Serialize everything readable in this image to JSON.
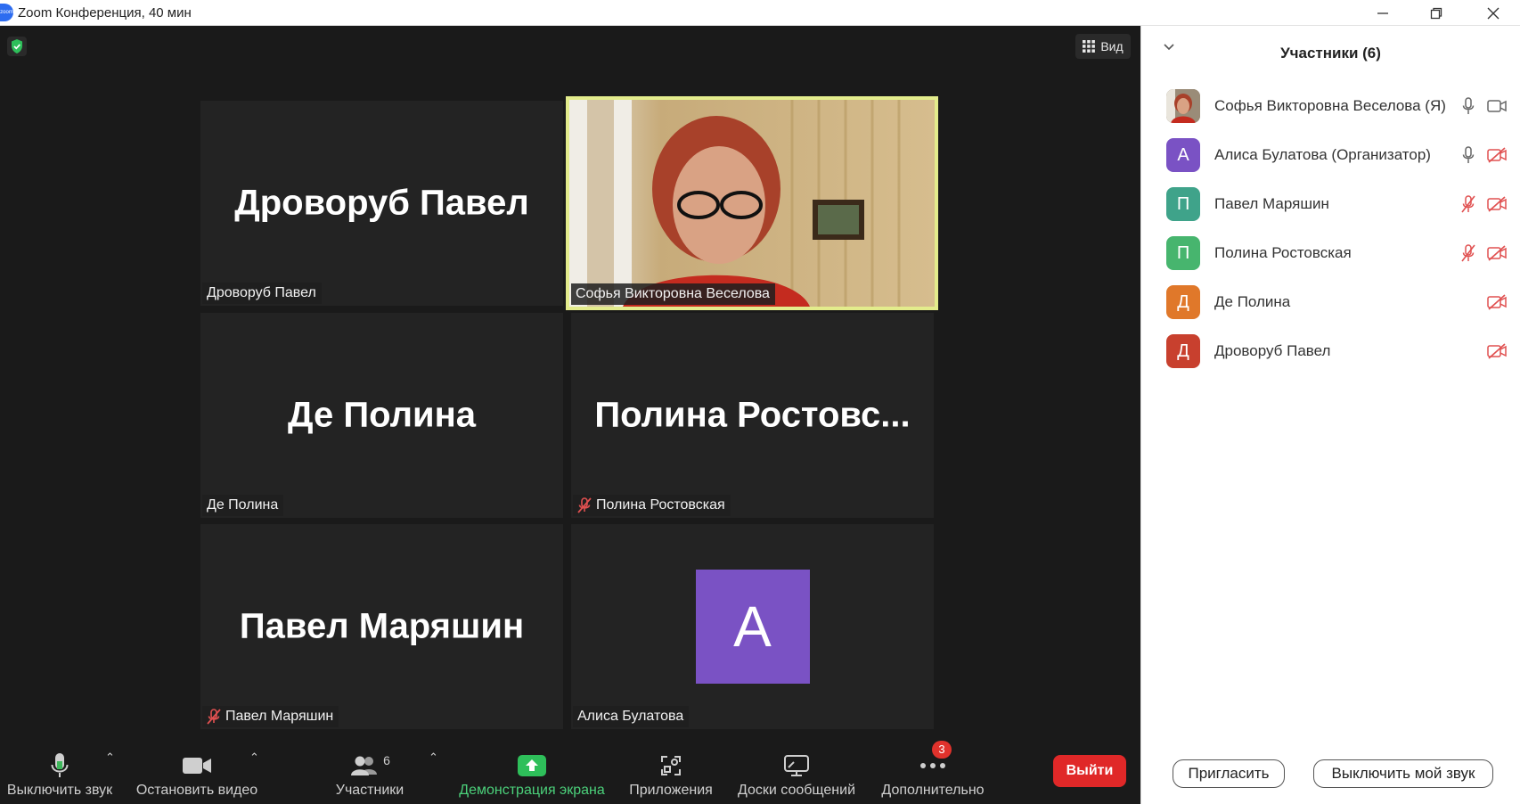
{
  "window": {
    "app_icon_text": "zoom",
    "title": "Zoom Конференция, 40 мин"
  },
  "meeting": {
    "view_label": "Вид",
    "tiles": [
      {
        "big_name": "Дроворуб Павел",
        "label": "Дроворуб Павел",
        "muted": false
      },
      {
        "big_name": "",
        "label": "Софья Викторовна Веселова",
        "muted": false,
        "video": true,
        "active_speaker": true
      },
      {
        "big_name": "Де Полина",
        "label": "Де Полина",
        "muted": false
      },
      {
        "big_name": "Полина  Ростовс...",
        "label": "Полина Ростовская",
        "muted": true
      },
      {
        "big_name": "Павел Маряшин",
        "label": "Павел Маряшин",
        "muted": true
      },
      {
        "big_name": "",
        "avatar_letter": "А",
        "label": "Алиса Булатова",
        "muted": false
      }
    ]
  },
  "toolbar": {
    "mute": "Выключить звук",
    "stop_video": "Остановить видео",
    "participants": "Участники",
    "participants_count": "6",
    "share": "Демонстрация экрана",
    "apps": "Приложения",
    "whiteboards": "Доски сообщений",
    "more": "Дополнительно",
    "more_badge": "3",
    "leave": "Выйти"
  },
  "panel": {
    "title": "Участники (6)",
    "participants": [
      {
        "name": "Софья Викторовна Веселова (Я)",
        "avatar": "",
        "avatar_color": "#8a7a66",
        "mic": "on",
        "video": "on"
      },
      {
        "name": "Алиса Булатова (Организатор)",
        "avatar": "А",
        "avatar_color": "#7a52c4",
        "mic": "on",
        "video": "off"
      },
      {
        "name": "Павел Маряшин",
        "avatar": "П",
        "avatar_color": "#3fa38a",
        "mic": "muted",
        "video": "off"
      },
      {
        "name": "Полина Ростовская",
        "avatar": "П",
        "avatar_color": "#47b56e",
        "mic": "muted",
        "video": "off"
      },
      {
        "name": "Де Полина",
        "avatar": "Д",
        "avatar_color": "#e0782a",
        "mic": "none",
        "video": "off"
      },
      {
        "name": "Дроворуб Павел",
        "avatar": "Д",
        "avatar_color": "#c8402e",
        "mic": "none",
        "video": "off"
      }
    ],
    "invite": "Пригласить",
    "mute_me": "Выключить мой звук"
  },
  "colors": {
    "meeting_bg": "#1a1a1a",
    "tile_bg": "#232323",
    "active_border": "#e3ec8c",
    "share_green": "#4bd07a",
    "leave_red": "#e02828",
    "muted_red": "#e05050"
  }
}
